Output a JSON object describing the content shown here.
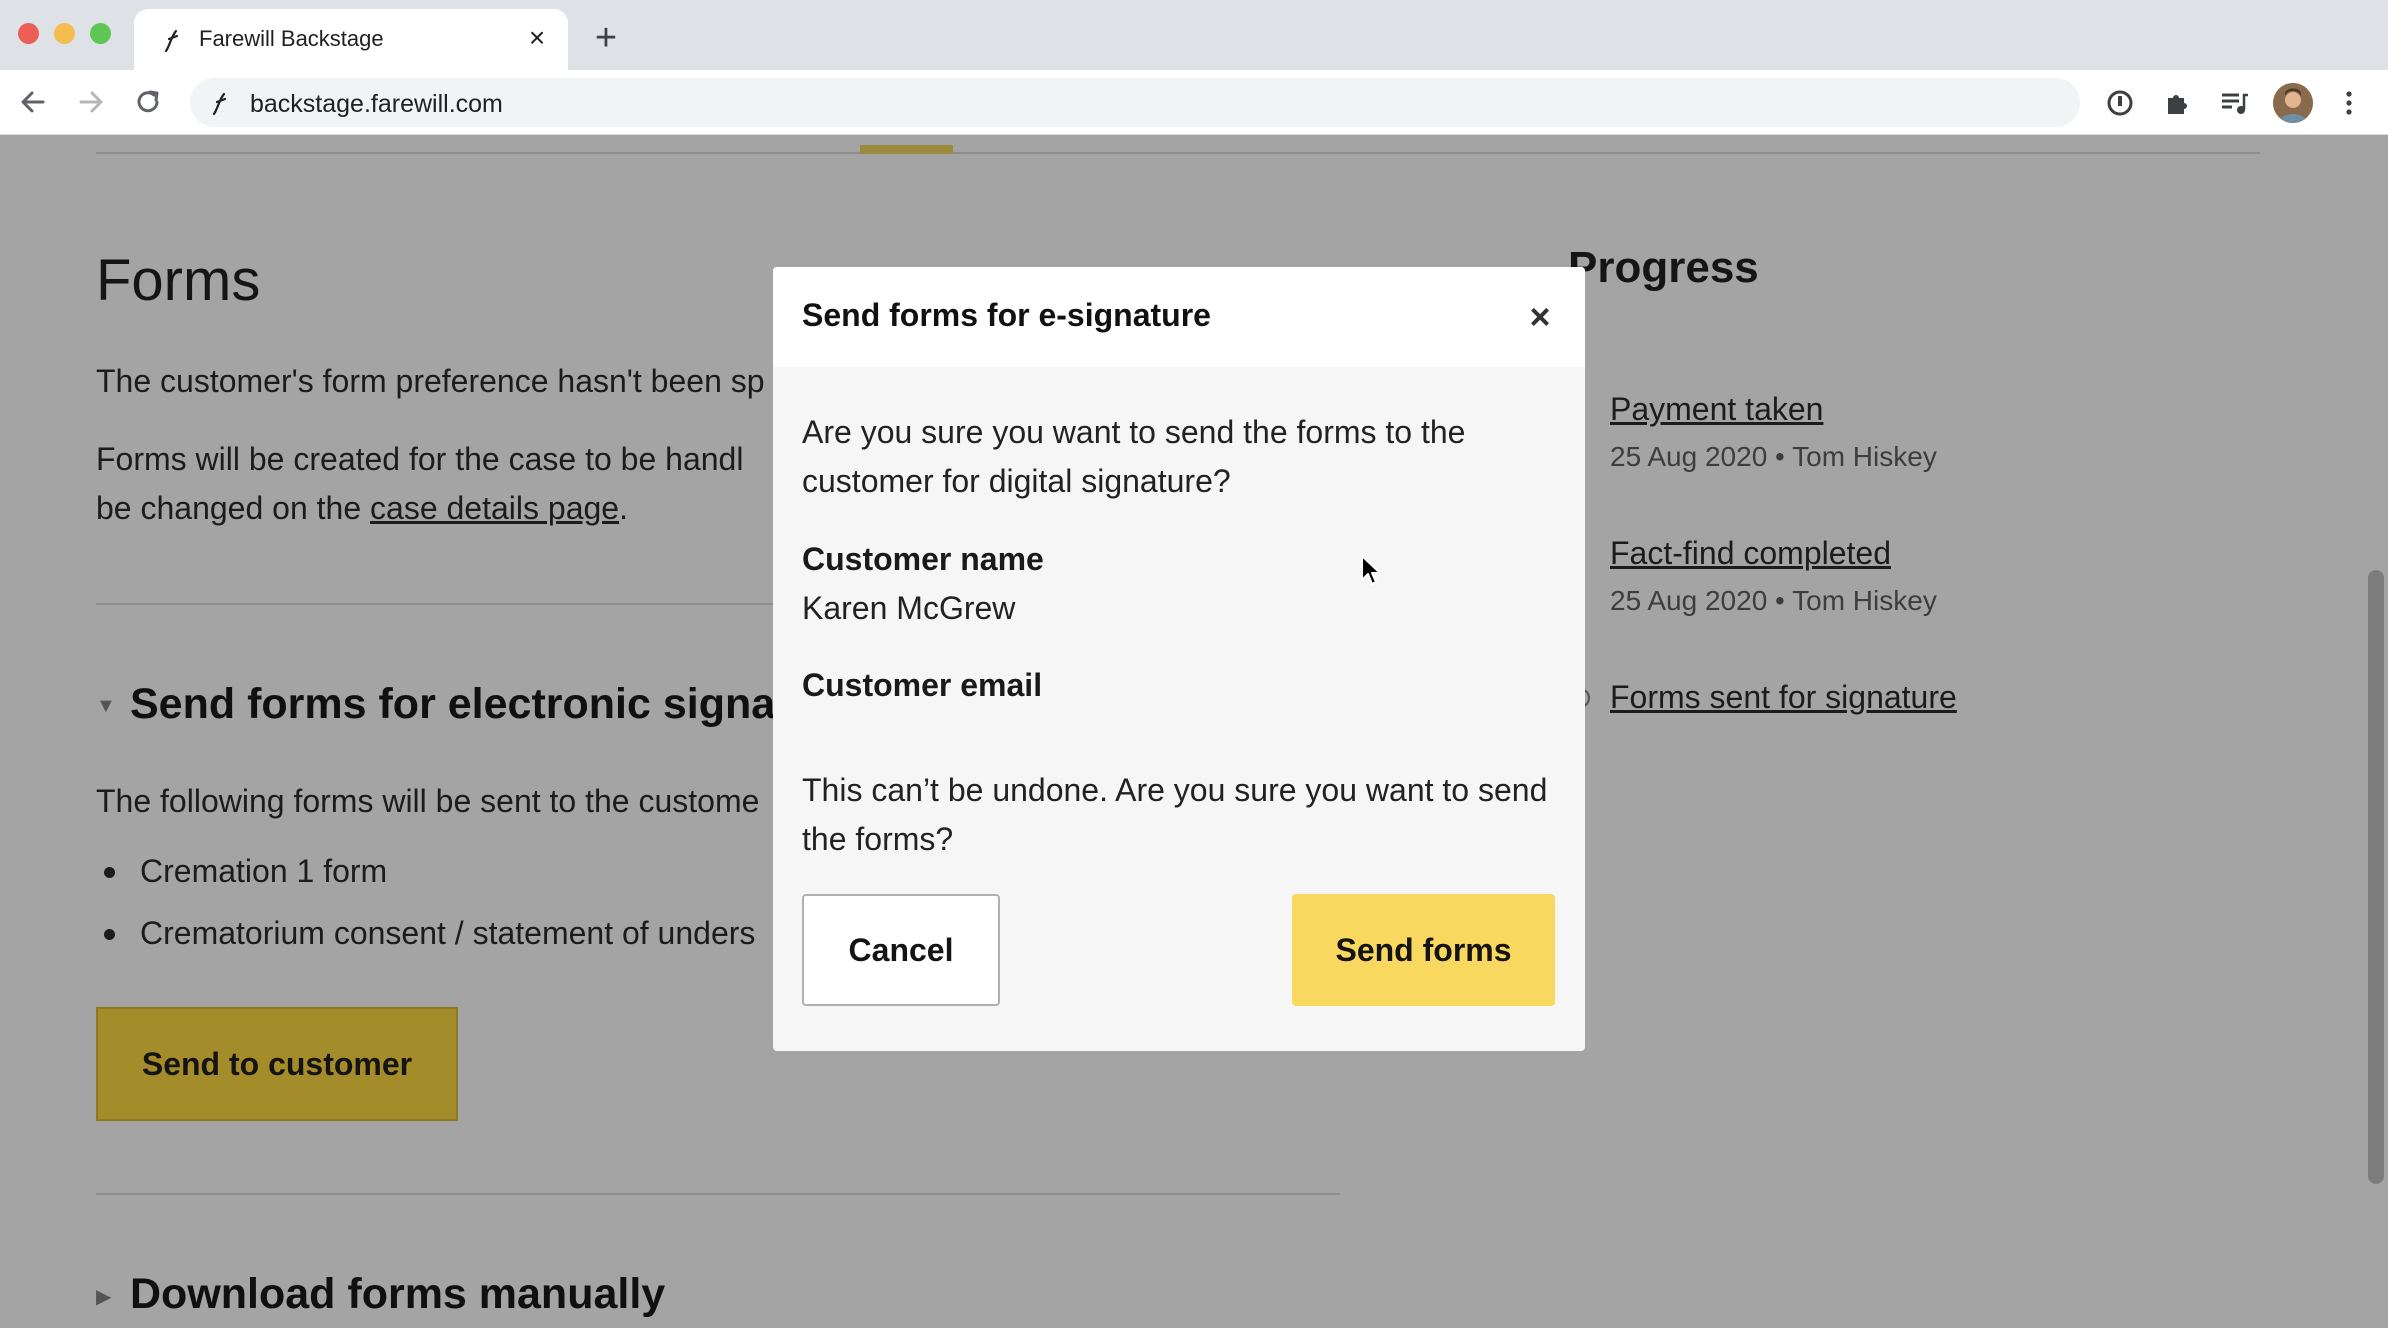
{
  "browser": {
    "tab_title": "Farewill Backstage",
    "tab_close": "×",
    "new_tab": "+",
    "url": "backstage.farewill.com"
  },
  "page": {
    "forms_title": "Forms",
    "preference_text": "The customer's form preference hasn't been sp",
    "handling_line1": "Forms will be created for the case to be handl",
    "handling_line2_prefix": "be changed on the ",
    "handling_link": "case details page",
    "handling_line2_suffix": ".",
    "esign_section_title": "Send forms for electronic signa",
    "list_intro": "The following forms will be sent to the custome",
    "forms_list": [
      "Cremation 1 form",
      "Crematorium consent / statement of unders"
    ],
    "send_to_customer_label": "Send to customer",
    "download_section_title": "Download forms manually"
  },
  "progress": {
    "title": "Progress",
    "items": [
      {
        "label": "Payment taken",
        "meta": "25 Aug 2020 • Tom Hiskey"
      },
      {
        "label": "Fact-find completed",
        "meta": "25 Aug 2020 • Tom Hiskey"
      },
      {
        "label": "Forms sent for signature",
        "meta": ""
      }
    ]
  },
  "modal": {
    "title": "Send forms for e-signature",
    "close": "×",
    "question": "Are you sure you want to send the forms to the customer for digital signature?",
    "customer_name_label": "Customer name",
    "customer_name_value": "Karen McGrew",
    "customer_email_label": "Customer email",
    "customer_email_value": "",
    "warning": "This can’t be undone. Are you sure you want to send the forms?",
    "cancel_label": "Cancel",
    "send_label": "Send forms"
  },
  "colors": {
    "modal_primary_button": "#f8d85e",
    "overlay_background": "#a4a4a4",
    "underlay_button": "#a58c2b"
  },
  "icons": {
    "back": "arrow-left-icon",
    "forward": "arrow-right-icon",
    "reload": "reload-icon",
    "password": "password-manager-icon",
    "extensions": "puzzle-icon",
    "media": "media-control-icon",
    "menu": "kebab-menu-icon"
  }
}
